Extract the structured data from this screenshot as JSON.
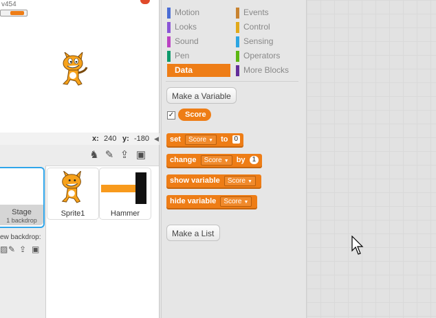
{
  "stage": {
    "version": "v454",
    "sprite_name": "Sprite1"
  },
  "coords": {
    "x_label": "x:",
    "x_value": "240",
    "y_label": "y:",
    "y_value": "-180"
  },
  "stage_panel": {
    "thumb_title": "Stage",
    "thumb_subtitle": "1 backdrop",
    "new_backdrop_label": "ew backdrop:"
  },
  "sprites": [
    {
      "name": "Sprite1"
    },
    {
      "name": "Hammer"
    }
  ],
  "categories": [
    {
      "label": "Motion",
      "color": "#4a6cd4"
    },
    {
      "label": "Events",
      "color": "#c88330"
    },
    {
      "label": "Looks",
      "color": "#8a55d7"
    },
    {
      "label": "Control",
      "color": "#e1a91a"
    },
    {
      "label": "Sound",
      "color": "#bb42c3"
    },
    {
      "label": "Sensing",
      "color": "#2ca5e2"
    },
    {
      "label": "Pen",
      "color": "#0e9a6c"
    },
    {
      "label": "Operators",
      "color": "#5cb712"
    },
    {
      "label": "Data",
      "color": "#ee7d16"
    },
    {
      "label": "More Blocks",
      "color": "#632d99"
    }
  ],
  "palette": {
    "make_variable": "Make a Variable",
    "variable_name": "Score",
    "variable_checked": "✓",
    "make_list": "Make a List",
    "blocks": {
      "set": {
        "kw1": "set",
        "var": "Score",
        "kw2": "to",
        "value": "0"
      },
      "change": {
        "kw1": "change",
        "var": "Score",
        "kw2": "by",
        "value": "1"
      },
      "show": {
        "kw1": "show variable",
        "var": "Score"
      },
      "hide": {
        "kw1": "hide variable",
        "var": "Score"
      }
    }
  },
  "colors": {
    "data_orange": "#ee7d16",
    "selection_blue": "#2fa5ea"
  }
}
